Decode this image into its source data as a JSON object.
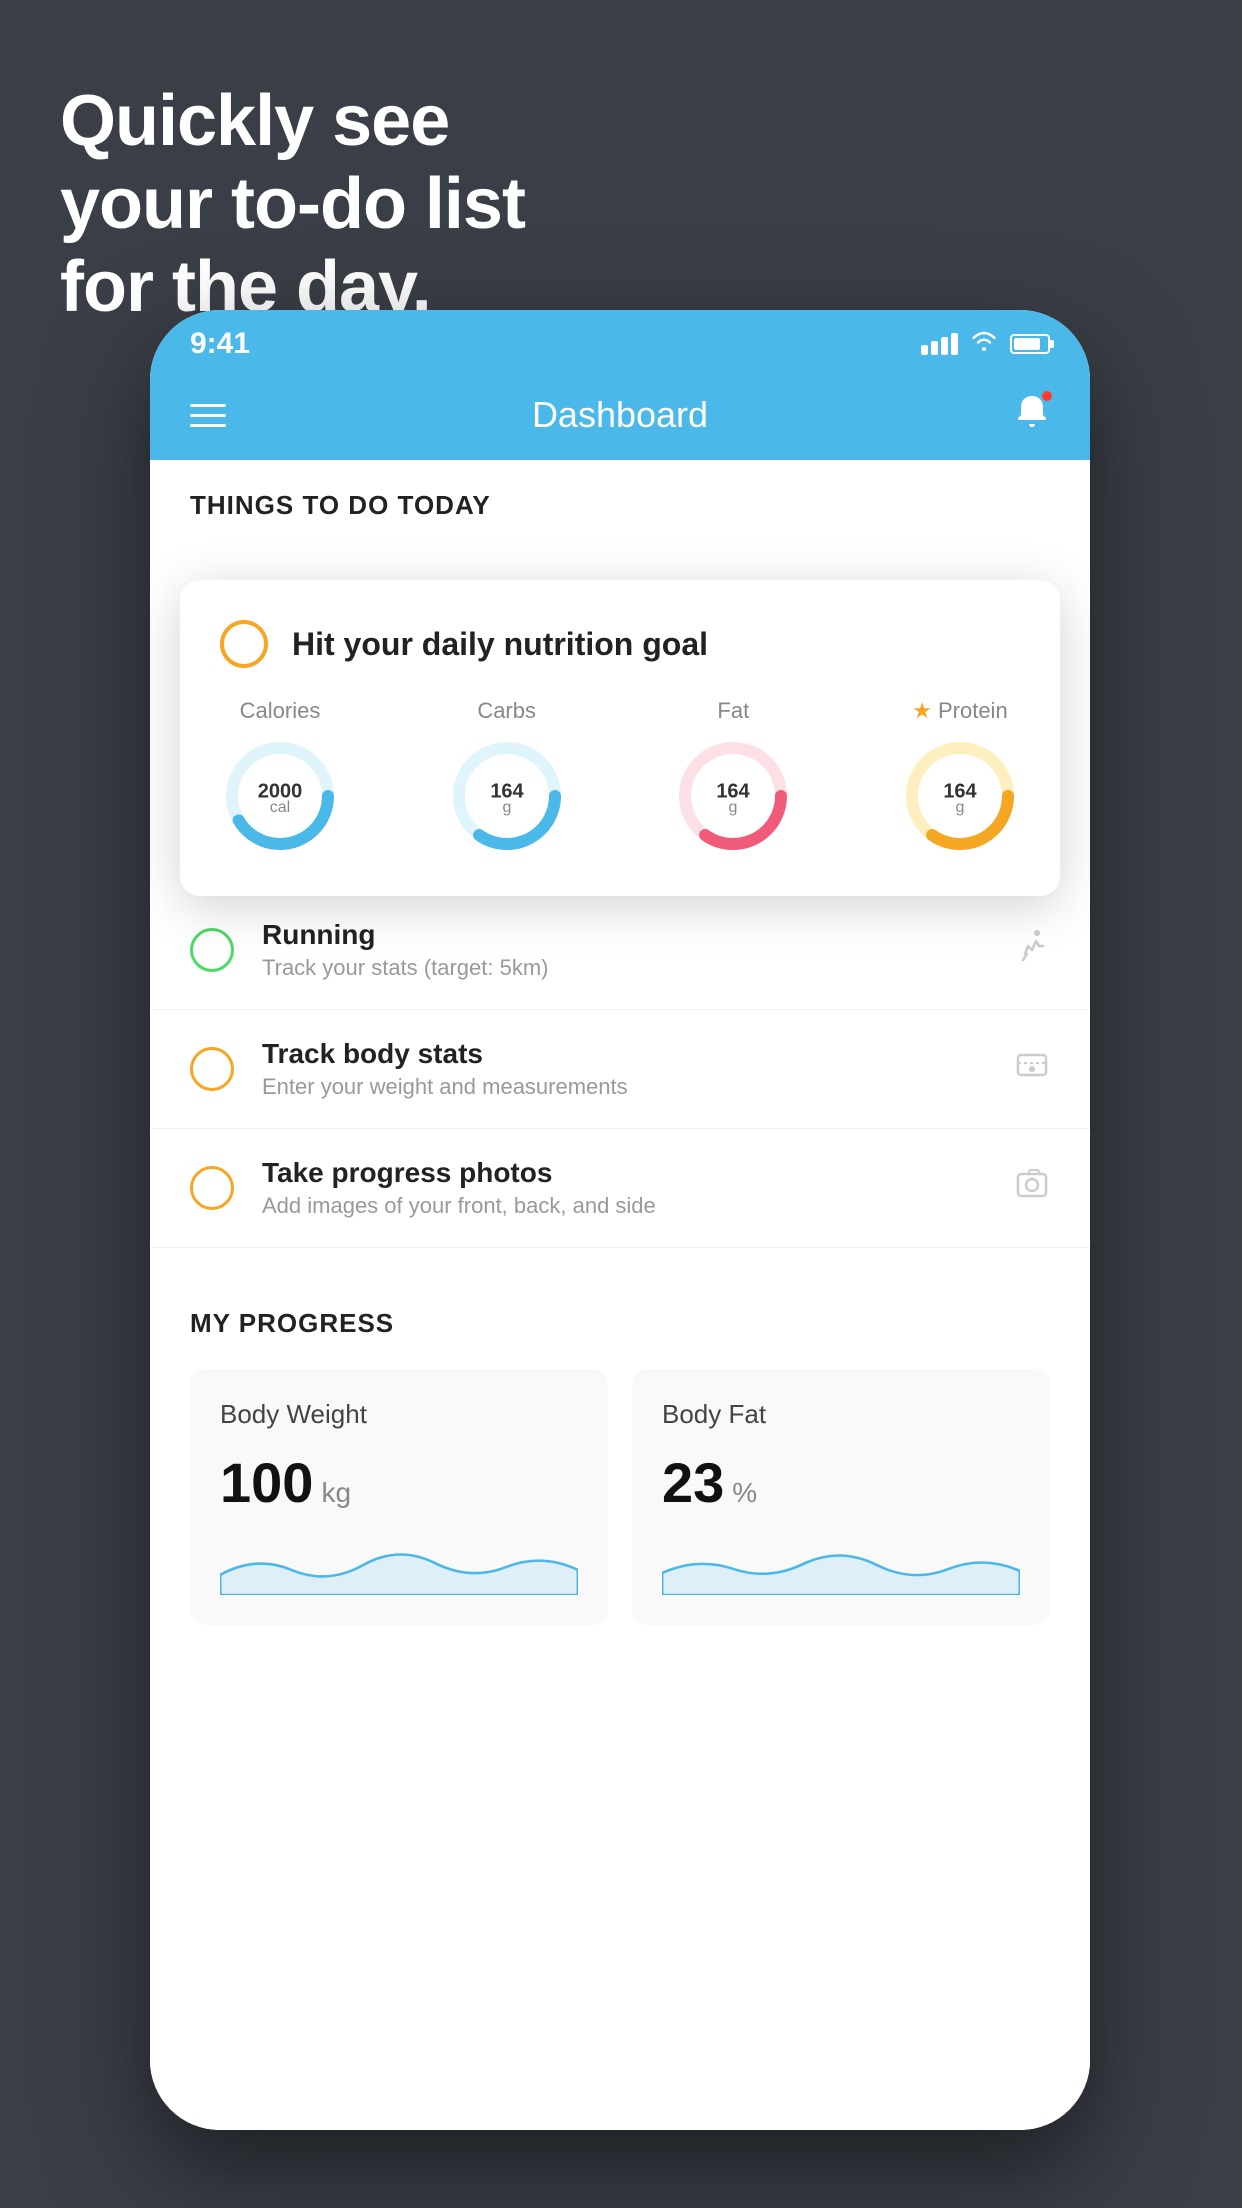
{
  "headline": {
    "line1": "Quickly see",
    "line2": "your to-do list",
    "line3": "for the day."
  },
  "statusBar": {
    "time": "9:41"
  },
  "navBar": {
    "title": "Dashboard"
  },
  "thingsSection": {
    "title": "THINGS TO DO TODAY"
  },
  "floatingCard": {
    "title": "Hit your daily nutrition goal",
    "items": [
      {
        "label": "Calories",
        "value": "2000",
        "unit": "cal",
        "color": "#4ab8e8",
        "star": false
      },
      {
        "label": "Carbs",
        "value": "164",
        "unit": "g",
        "color": "#4ab8e8",
        "star": false
      },
      {
        "label": "Fat",
        "value": "164",
        "unit": "g",
        "color": "#f05b7a",
        "star": false
      },
      {
        "label": "Protein",
        "value": "164",
        "unit": "g",
        "color": "#f5a623",
        "star": true
      }
    ]
  },
  "todoItems": [
    {
      "name": "Running",
      "desc": "Track your stats (target: 5km)",
      "circleColor": "green",
      "icon": "👟"
    },
    {
      "name": "Track body stats",
      "desc": "Enter your weight and measurements",
      "circleColor": "yellow",
      "icon": "⚖"
    },
    {
      "name": "Take progress photos",
      "desc": "Add images of your front, back, and side",
      "circleColor": "yellow",
      "icon": "🖼"
    }
  ],
  "progressSection": {
    "title": "MY PROGRESS",
    "cards": [
      {
        "title": "Body Weight",
        "value": "100",
        "unit": "kg"
      },
      {
        "title": "Body Fat",
        "value": "23",
        "unit": "%"
      }
    ]
  }
}
